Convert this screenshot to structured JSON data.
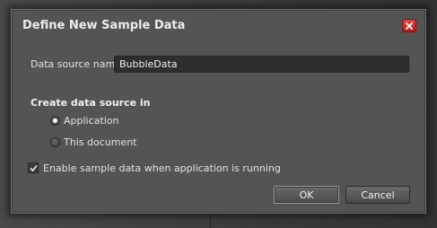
{
  "dialog": {
    "title": "Define New Sample Data",
    "close_icon": "close-icon",
    "colors": {
      "background": "#545454",
      "close_button": "#c83030",
      "input_background": "#2e2e2e"
    }
  },
  "data_source_name": {
    "label": "Data source name",
    "value": "BubbleData"
  },
  "create_in": {
    "heading": "Create data source in",
    "options": [
      {
        "label": "Application",
        "selected": true
      },
      {
        "label": "This document",
        "selected": false
      }
    ]
  },
  "enable_sample": {
    "label": "Enable sample data when application is running",
    "checked": true
  },
  "buttons": {
    "ok_label": "OK",
    "cancel_label": "Cancel"
  }
}
